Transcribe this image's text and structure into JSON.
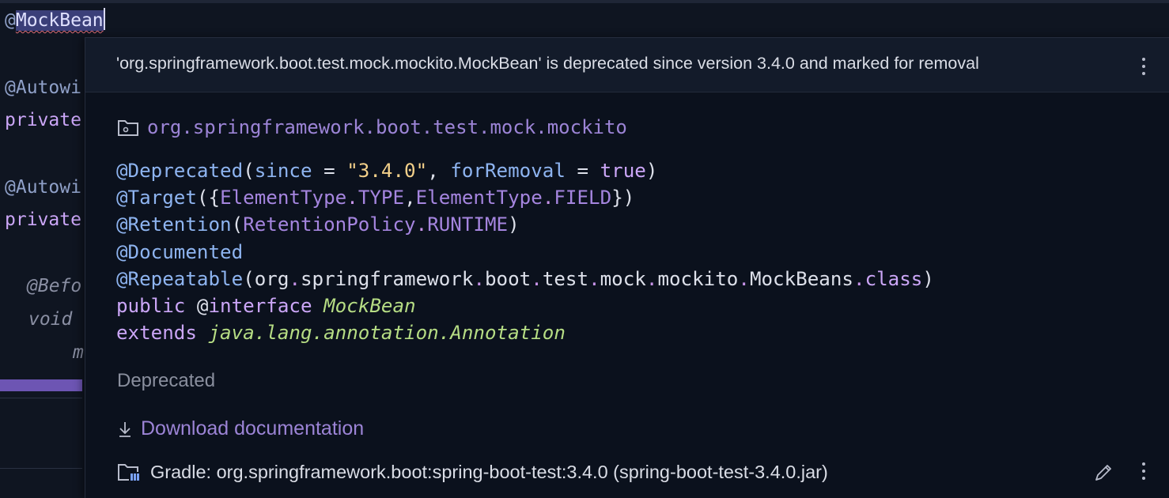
{
  "editor": {
    "lines": [
      {
        "at": "@",
        "word": "MockBean"
      },
      {
        "text": "@Autowi"
      },
      {
        "text": "private"
      },
      {
        "text": "@Autowi"
      },
      {
        "text": "private"
      },
      {
        "text": "@Befo"
      },
      {
        "text": "void"
      },
      {
        "text": "m"
      }
    ]
  },
  "popup": {
    "header": "'org.springframework.boot.test.mock.mockito.MockBean' is deprecated since version 3.4.0 and marked for removal",
    "package": "org.springframework.boot.test.mock.mockito",
    "signature": {
      "l1": {
        "ann": "@Deprecated",
        "open": "(",
        "p1": "since",
        "eq1": " = ",
        "s1": "\"3.4.0\"",
        "comma": ", ",
        "p2": "forRemoval",
        "eq2": " = ",
        "b1": "true",
        "close": ")"
      },
      "l2": {
        "ann": "@Target",
        "open": "({",
        "e1": "ElementType",
        "d1": ".",
        "e1b": "TYPE",
        "comma": ",",
        "e2": "ElementType",
        "d2": ".",
        "e2b": "FIELD",
        "close": "})"
      },
      "l3": {
        "ann": "@Retention",
        "open": "(",
        "e1": "RetentionPolicy",
        "d1": ".",
        "e1b": "RUNTIME",
        "close": ")"
      },
      "l4": {
        "ann": "@Documented"
      },
      "l5": {
        "ann": "@Repeatable",
        "open": "(",
        "p1": "org",
        "p2": "springframework",
        "p3": "boot",
        "p4": "test",
        "p5": "mock",
        "p6": "mockito",
        "p7": "MockBeans",
        "p8": "class",
        "dot": ".",
        "close": ")"
      },
      "l6": {
        "kw": "public",
        "at": " @",
        "kw2": "interface",
        "name": "MockBean"
      },
      "l7": {
        "kw": "extends",
        "name": "java.lang.annotation.Annotation"
      }
    },
    "deprecated_label": "Deprecated",
    "download_label": "Download documentation",
    "gradle_label": "Gradle: org.springframework.boot:spring-boot-test:3.4.0 (spring-boot-test-3.4.0.jar)"
  },
  "icons": {
    "folder": "folder-icon",
    "download": "download-icon",
    "library": "library-icon",
    "edit": "pencil-icon",
    "more": "more-vertical-icon"
  }
}
